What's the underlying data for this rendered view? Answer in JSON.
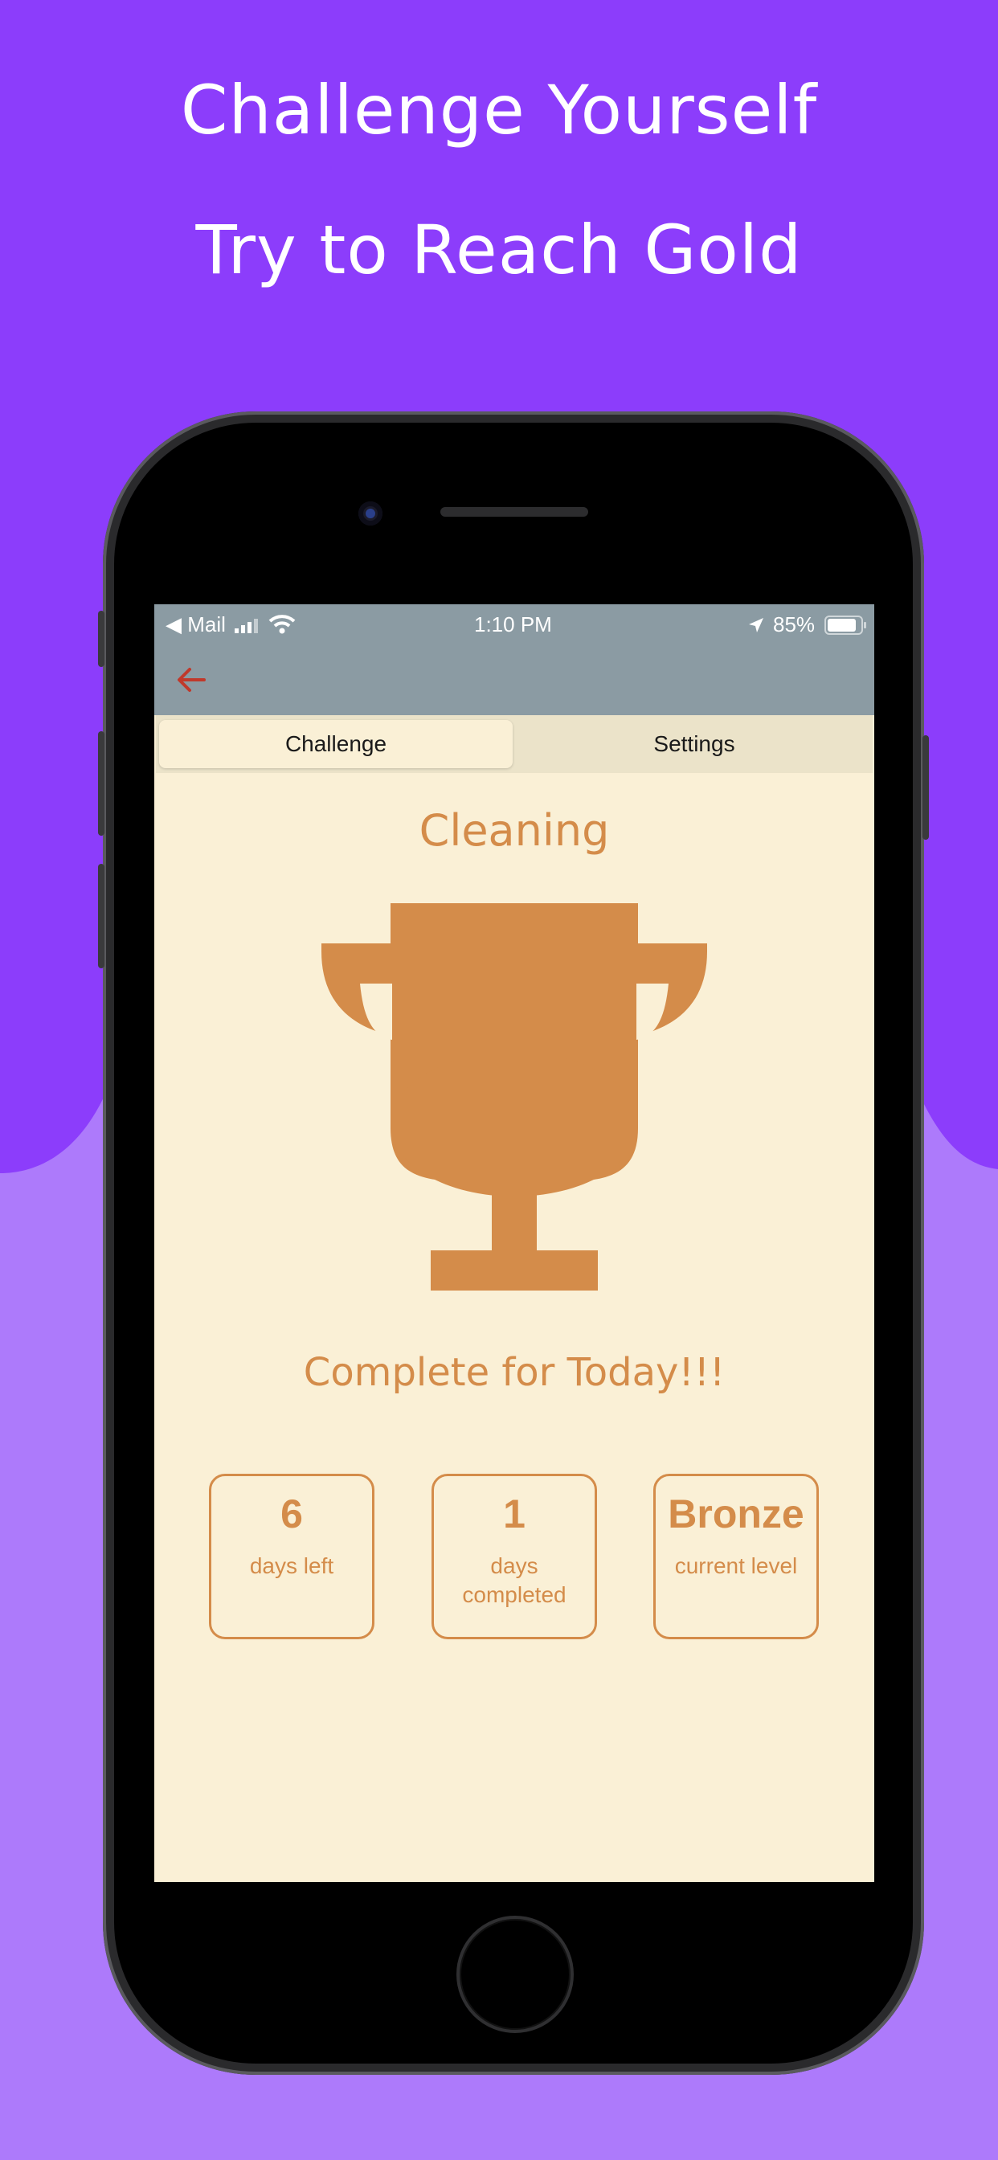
{
  "headline": {
    "line1": "Challenge Yourself",
    "line2": "Try to Reach Gold"
  },
  "colors": {
    "background_top": "#8c3dfb",
    "background_bottom": "#ad7afb",
    "screen_background": "#faf0d6",
    "status_bar": "#8b9ba3",
    "accent_bronze": "#d48c4a",
    "back_arrow": "#c0392b"
  },
  "status_bar": {
    "carrier": "◀ Mail",
    "time": "1:10 PM",
    "battery": "85%"
  },
  "nav": {
    "back_icon": "arrow-left-icon"
  },
  "tabs": [
    {
      "label": "Challenge",
      "selected": true
    },
    {
      "label": "Settings",
      "selected": false
    }
  ],
  "challenge": {
    "name": "Cleaning",
    "trophy_icon": "trophy-icon",
    "message": "Complete for Today!!!"
  },
  "stats": [
    {
      "value": "6",
      "label": "days left"
    },
    {
      "value": "1",
      "label": "days completed"
    },
    {
      "value": "Bronze",
      "label": "current level"
    }
  ]
}
